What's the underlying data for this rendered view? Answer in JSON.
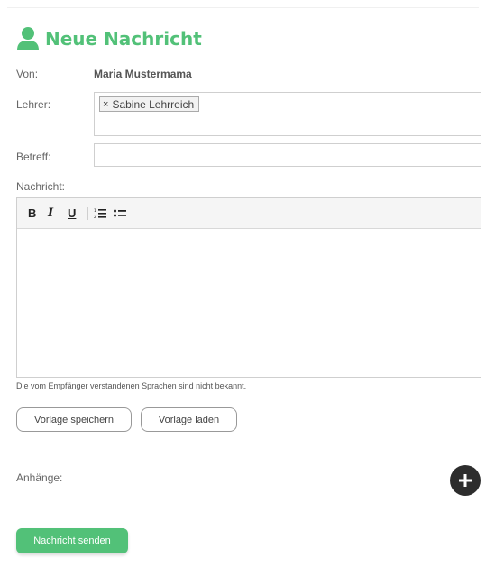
{
  "header": {
    "title": "Neue Nachricht",
    "icon": "user-icon",
    "accent_color": "#52c178"
  },
  "form": {
    "from_label": "Von:",
    "from_value": "Maria Mustermama",
    "teacher_label": "Lehrer:",
    "teacher_tags": [
      "Sabine Lehrreich"
    ],
    "subject_label": "Betreff:",
    "subject_value": "",
    "message_label": "Nachricht:"
  },
  "editor": {
    "toolbar": {
      "bold": "B",
      "italic": "I",
      "underline": "U"
    }
  },
  "hint": "Die vom Empfänger verstandenen Sprachen sind nicht bekannt.",
  "buttons": {
    "save_template": "Vorlage speichern",
    "load_template": "Vorlage laden",
    "send": "Nachricht senden"
  },
  "attachments": {
    "label": "Anhänge:",
    "add_icon": "plus-icon"
  }
}
